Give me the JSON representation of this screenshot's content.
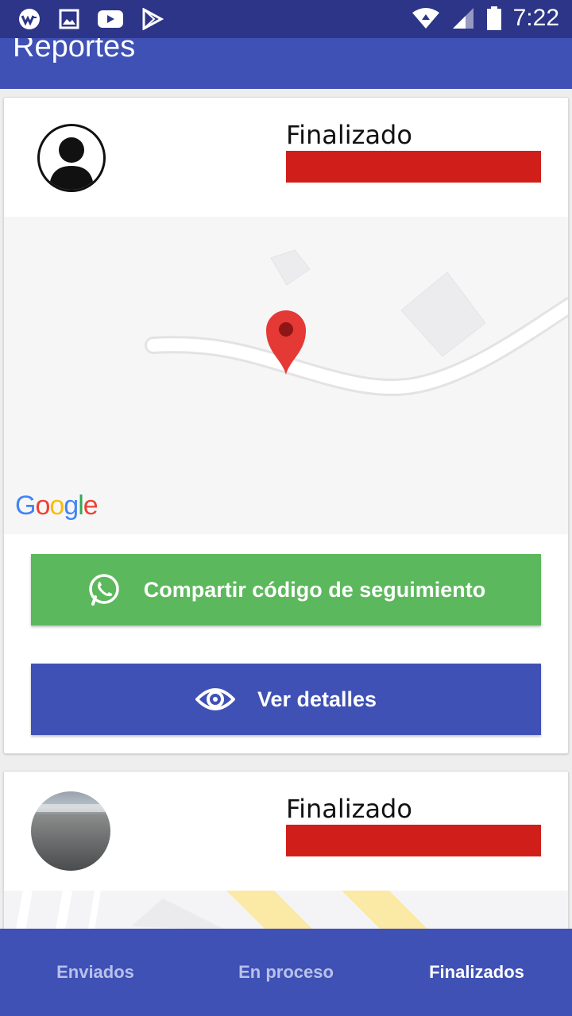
{
  "status_bar": {
    "time": "7:22",
    "left_icons": [
      "wm-icon",
      "image-icon",
      "youtube-icon",
      "play-store-icon"
    ],
    "right_icons": [
      "wifi-icon",
      "signal-icon",
      "battery-icon"
    ]
  },
  "app_bar": {
    "title": "Reportes"
  },
  "cards": [
    {
      "status": "Finalizado",
      "status_color": "#d01f1a",
      "map_logo": "Google",
      "share_button": "Compartir código de seguimiento",
      "details_button": "Ver detalles"
    },
    {
      "status": "Finalizado",
      "status_color": "#d01f1a"
    }
  ],
  "bottom_nav": {
    "tabs": [
      "Enviados",
      "En proceso",
      "Finalizados"
    ],
    "active": "Finalizados"
  },
  "colors": {
    "primary": "#3f51b5",
    "primary_dark": "#2c3587",
    "green": "#5cb85c",
    "red": "#d01f1a"
  }
}
